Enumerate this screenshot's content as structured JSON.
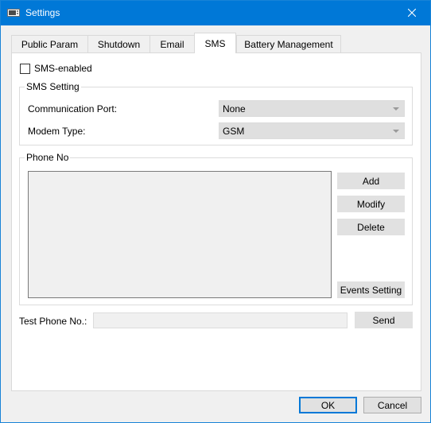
{
  "window": {
    "title": "Settings"
  },
  "tabs": [
    {
      "label": "Public Param"
    },
    {
      "label": "Shutdown"
    },
    {
      "label": "Email"
    },
    {
      "label": "SMS"
    },
    {
      "label": "Battery Management"
    }
  ],
  "sms": {
    "enabled_label": "SMS-enabled",
    "enabled": false,
    "setting": {
      "legend": "SMS Setting",
      "port_label": "Communication Port:",
      "port_value": "None",
      "modem_label": "Modem Type:",
      "modem_value": "GSM"
    },
    "phone": {
      "legend": "Phone No",
      "entries": [],
      "add_label": "Add",
      "modify_label": "Modify",
      "delete_label": "Delete",
      "events_label": "Events Setting"
    },
    "test": {
      "label": "Test Phone No.:",
      "value": "",
      "send_label": "Send"
    }
  },
  "footer": {
    "ok_label": "OK",
    "cancel_label": "Cancel"
  }
}
